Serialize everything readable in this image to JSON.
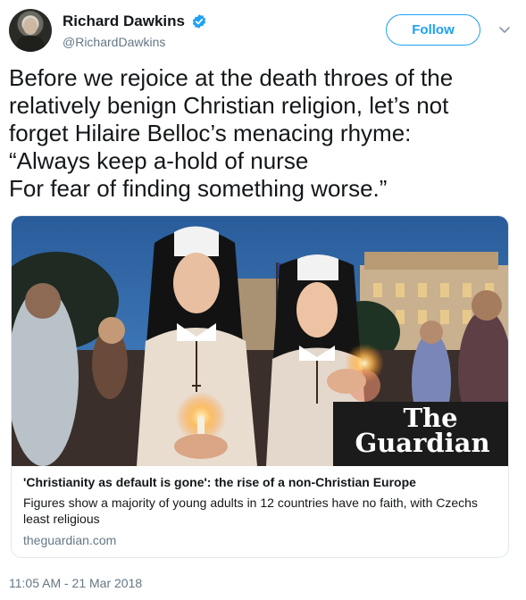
{
  "author": {
    "display_name": "Richard Dawkins",
    "handle": "@RichardDawkins",
    "avatar_icon": "profile-photo"
  },
  "follow_button": {
    "label": "Follow"
  },
  "menu_icon": "chevron-down-icon",
  "tweet": {
    "text": "Before we rejoice at the death throes of the\nrelatively benign Christian religion, let’s not\nforget Hilaire Belloc’s menacing rhyme:\n“Always keep a-hold of nurse\nFor fear of finding something worse.”",
    "timestamp": "11:05 AM - 21 Mar 2018"
  },
  "card": {
    "image_logo": {
      "line1": "The",
      "line2": "Guardian"
    },
    "title": "'Christianity as default is gone': the rise of a non-Christian Europe",
    "description": "Figures show a majority of young adults in 12 countries have no faith, with Czechs least religious",
    "domain": "theguardian.com"
  },
  "colors": {
    "accent": "#1da1f2",
    "secondary_text": "#657786",
    "border": "#e1e8ed"
  }
}
